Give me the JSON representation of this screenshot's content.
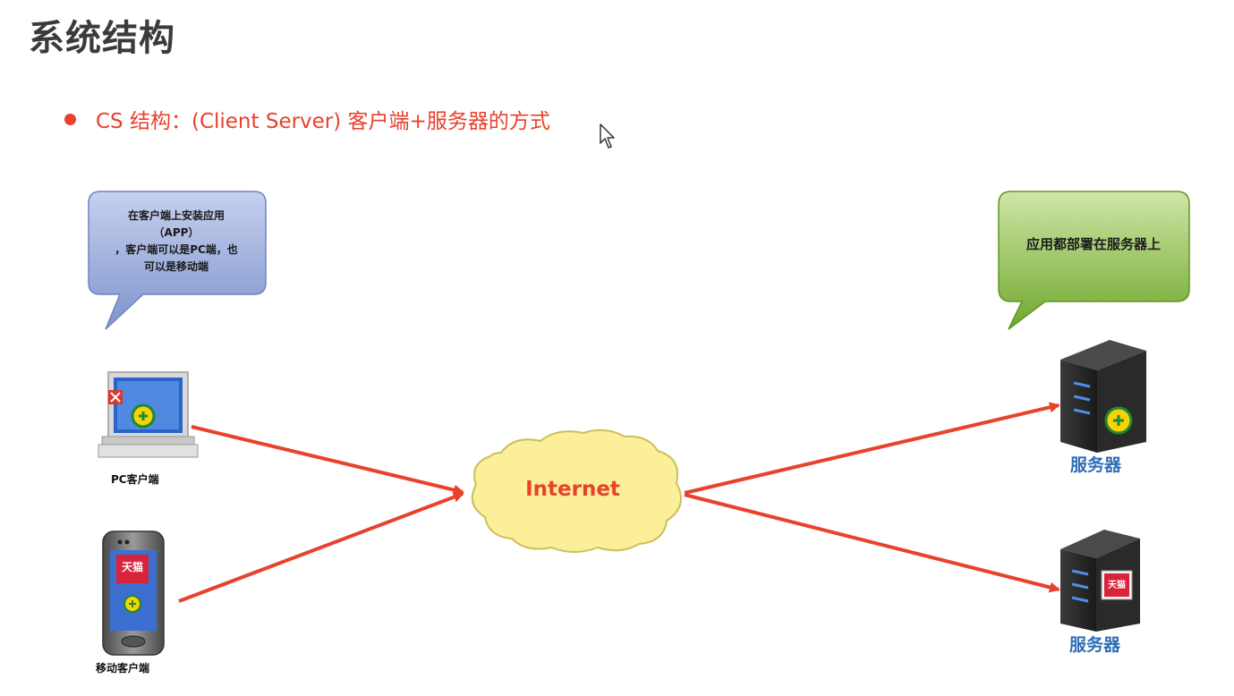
{
  "slide": {
    "title": "系统结构",
    "bullet": "CS 结构：(Client Server) 客户端+服务器的方式"
  },
  "diagram": {
    "client_bubble": {
      "lines": [
        "在客户端上安装应用",
        "（APP）",
        "，客户端可以是PC端，也",
        "可以是移动端"
      ]
    },
    "server_bubble": {
      "text": "应用都部署在服务器上"
    },
    "nodes": {
      "pc_client": "PC客户端",
      "mobile_client": "移动客户端",
      "internet": "Internet",
      "server_1": "服务器",
      "server_2": "服务器"
    },
    "app_labels": {
      "tmall": "天猫"
    }
  },
  "colors": {
    "title": "#3a3a3a",
    "accent_red": "#e8412c",
    "client_bubble": "#8a9fd6",
    "server_bubble": "#84ba3e",
    "cloud": "#fbef9a",
    "server_label": "#2f6db5"
  }
}
